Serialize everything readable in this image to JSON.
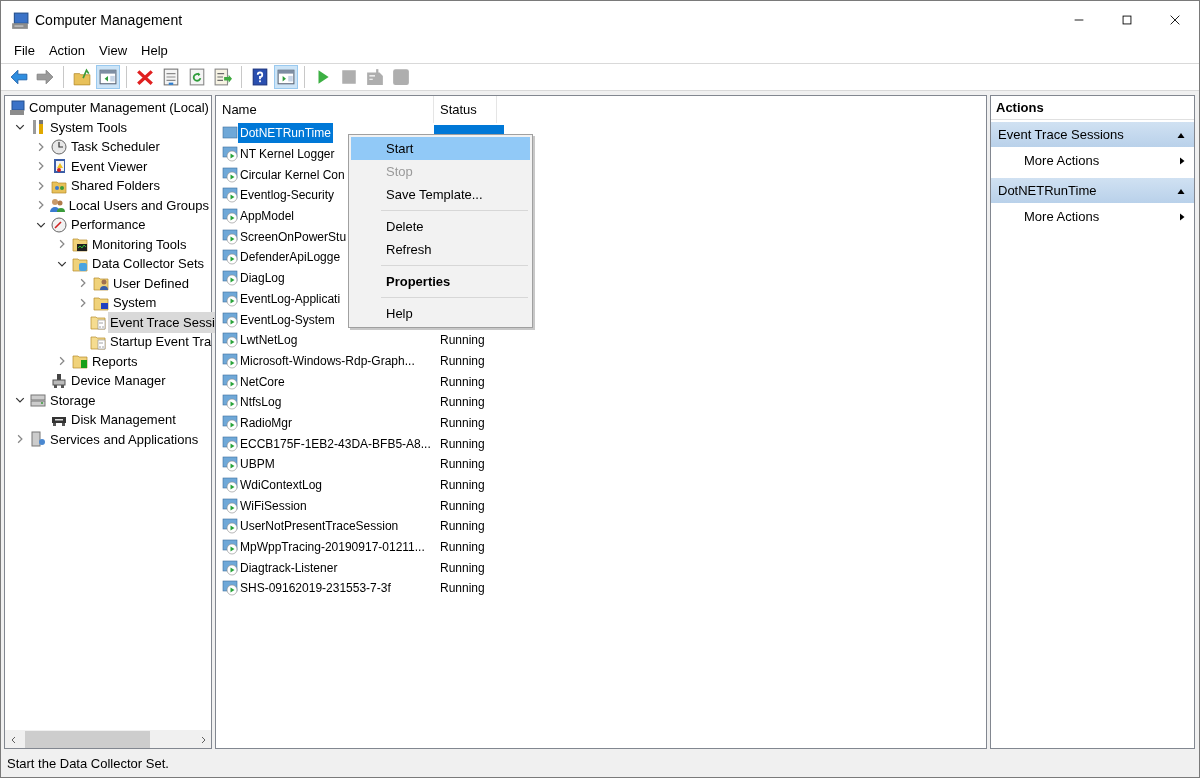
{
  "window": {
    "title": "Computer Management"
  },
  "menu": [
    "File",
    "Action",
    "View",
    "Help"
  ],
  "toolbar": [
    {
      "kind": "back",
      "pressed": false,
      "disabled": false
    },
    {
      "kind": "forward",
      "pressed": false,
      "disabled": true
    },
    {
      "kind": "separator"
    },
    {
      "kind": "up-folder",
      "pressed": false,
      "disabled": false
    },
    {
      "kind": "pane-left",
      "pressed": true,
      "disabled": false
    },
    {
      "kind": "separator"
    },
    {
      "kind": "delete",
      "pressed": false,
      "disabled": false
    },
    {
      "kind": "properties",
      "pressed": false,
      "disabled": false
    },
    {
      "kind": "refresh",
      "pressed": false,
      "disabled": false
    },
    {
      "kind": "export",
      "pressed": false,
      "disabled": false
    },
    {
      "kind": "separator"
    },
    {
      "kind": "help",
      "pressed": false,
      "disabled": false
    },
    {
      "kind": "pane-right",
      "pressed": true,
      "disabled": false
    },
    {
      "kind": "separator"
    },
    {
      "kind": "play",
      "pressed": false,
      "disabled": false
    },
    {
      "kind": "stop",
      "pressed": false,
      "disabled": true
    },
    {
      "kind": "report",
      "pressed": false,
      "disabled": true
    },
    {
      "kind": "square",
      "pressed": false,
      "disabled": true
    }
  ],
  "tree": [
    {
      "label": "Computer Management (Local)",
      "kind": "root",
      "selected": false,
      "children": [
        {
          "label": "System Tools",
          "kind": "expanded",
          "selected": false,
          "children": [
            {
              "label": "Task Scheduler",
              "kind": "collapsed",
              "selected": false
            },
            {
              "label": "Event Viewer",
              "kind": "collapsed",
              "selected": false
            },
            {
              "label": "Shared Folders",
              "kind": "collapsed",
              "selected": false
            },
            {
              "label": "Local Users and Groups",
              "kind": "collapsed",
              "selected": false
            },
            {
              "label": "Performance",
              "kind": "expanded",
              "selected": false,
              "children": [
                {
                  "label": "Monitoring Tools",
                  "kind": "collapsed",
                  "selected": false
                },
                {
                  "label": "Data Collector Sets",
                  "kind": "expanded",
                  "selected": false,
                  "children": [
                    {
                      "label": "User Defined",
                      "kind": "collapsed",
                      "selected": false
                    },
                    {
                      "label": "System",
                      "kind": "collapsed",
                      "selected": false
                    },
                    {
                      "label": "Event Trace Sessi",
                      "kind": "leaf",
                      "selected": true
                    },
                    {
                      "label": "Startup Event Tra",
                      "kind": "leaf",
                      "selected": false
                    }
                  ]
                },
                {
                  "label": "Reports",
                  "kind": "collapsed",
                  "selected": false
                }
              ]
            },
            {
              "label": "Device Manager",
              "kind": "leaf",
              "selected": false
            }
          ]
        },
        {
          "label": "Storage",
          "kind": "expanded",
          "selected": false,
          "children": [
            {
              "label": "Disk Management",
              "kind": "leaf",
              "selected": false
            }
          ]
        },
        {
          "label": "Services and Applications",
          "kind": "collapsed",
          "selected": false
        }
      ]
    }
  ],
  "list": {
    "columns": [
      "Name",
      "Status"
    ],
    "rows": [
      {
        "name": "DotNETRunTime",
        "running": false,
        "selected": true
      },
      {
        "name": "NT Kernel Logger",
        "running": true,
        "selected": false
      },
      {
        "name": "Circular Kernel Con",
        "running": true,
        "selected": false
      },
      {
        "name": "Eventlog-Security",
        "running": true,
        "selected": false
      },
      {
        "name": "AppModel",
        "running": true,
        "selected": false
      },
      {
        "name": "ScreenOnPowerStu",
        "running": true,
        "selected": false
      },
      {
        "name": "DefenderApiLogge",
        "running": true,
        "selected": false
      },
      {
        "name": "DiagLog",
        "running": true,
        "selected": false
      },
      {
        "name": "EventLog-Applicati",
        "running": true,
        "selected": false
      },
      {
        "name": "EventLog-System",
        "running": true,
        "selected": false
      },
      {
        "name": "LwtNetLog",
        "status": "Running",
        "running": true,
        "selected": false
      },
      {
        "name": "Microsoft-Windows-Rdp-Graph...",
        "status": "Running",
        "running": true,
        "selected": false
      },
      {
        "name": "NetCore",
        "status": "Running",
        "running": true,
        "selected": false
      },
      {
        "name": "NtfsLog",
        "status": "Running",
        "running": true,
        "selected": false
      },
      {
        "name": "RadioMgr",
        "status": "Running",
        "running": true,
        "selected": false
      },
      {
        "name": "ECCB175F-1EB2-43DA-BFB5-A8...",
        "status": "Running",
        "running": true,
        "selected": false
      },
      {
        "name": "UBPM",
        "status": "Running",
        "running": true,
        "selected": false
      },
      {
        "name": "WdiContextLog",
        "status": "Running",
        "running": true,
        "selected": false
      },
      {
        "name": "WiFiSession",
        "status": "Running",
        "running": true,
        "selected": false
      },
      {
        "name": "UserNotPresentTraceSession",
        "status": "Running",
        "running": true,
        "selected": false
      },
      {
        "name": "MpWppTracing-20190917-01211...",
        "status": "Running",
        "running": true,
        "selected": false
      },
      {
        "name": "Diagtrack-Listener",
        "status": "Running",
        "running": true,
        "selected": false
      },
      {
        "name": "SHS-09162019-231553-7-3f",
        "status": "Running",
        "running": true,
        "selected": false
      }
    ]
  },
  "context_menu": [
    {
      "kind": "item",
      "label": "Start",
      "selected": true,
      "disabled": false,
      "default": false
    },
    {
      "kind": "item",
      "label": "Stop",
      "selected": false,
      "disabled": true,
      "default": false
    },
    {
      "kind": "item",
      "label": "Save Template...",
      "selected": false,
      "disabled": false,
      "default": false
    },
    {
      "kind": "separator"
    },
    {
      "kind": "item",
      "label": "Delete",
      "selected": false,
      "disabled": false,
      "default": false
    },
    {
      "kind": "item",
      "label": "Refresh",
      "selected": false,
      "disabled": false,
      "default": false
    },
    {
      "kind": "separator"
    },
    {
      "kind": "item",
      "label": "Properties",
      "selected": false,
      "disabled": false,
      "default": true
    },
    {
      "kind": "separator"
    },
    {
      "kind": "item",
      "label": "Help",
      "selected": false,
      "disabled": false,
      "default": false
    }
  ],
  "actions": {
    "title": "Actions",
    "sections": [
      {
        "title": "Event Trace Sessions",
        "expanded": true,
        "items": [
          "More Actions"
        ]
      },
      {
        "title": "DotNETRunTime",
        "expanded": true,
        "items": [
          "More Actions"
        ]
      }
    ]
  },
  "status_bar": "Start the Data Collector Set."
}
